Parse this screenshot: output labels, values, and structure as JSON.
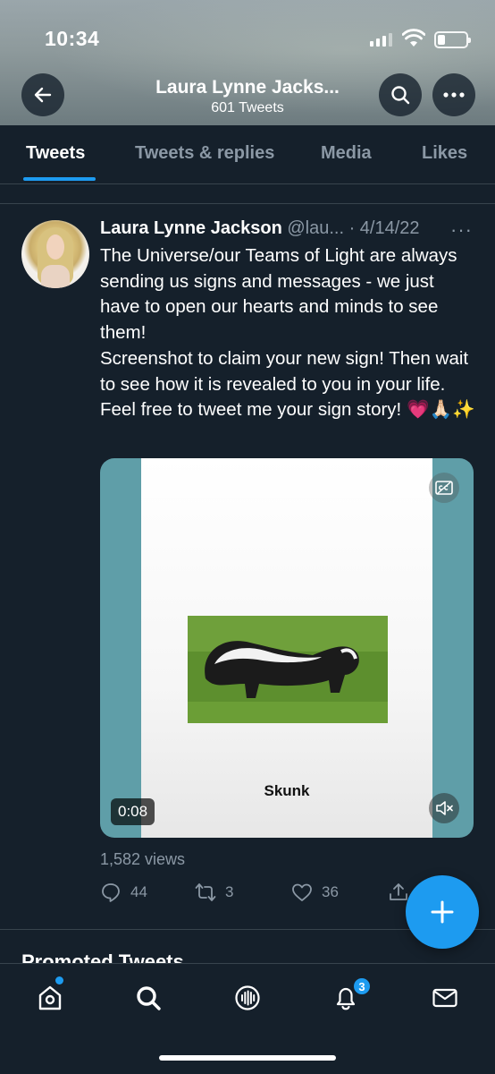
{
  "status_bar": {
    "time": "10:34",
    "battery_level": 0.25
  },
  "header": {
    "profile_name": "Laura Lynne Jacks...",
    "tweet_count": "601 Tweets",
    "back_icon": "arrow-left-icon",
    "search_icon": "search-icon",
    "more_icon": "more-horizontal-icon"
  },
  "tabs": [
    {
      "label": "Tweets",
      "active": true
    },
    {
      "label": "Tweets & replies",
      "active": false
    },
    {
      "label": "Media",
      "active": false
    },
    {
      "label": "Likes",
      "active": false
    }
  ],
  "tweet": {
    "author_name": "Laura Lynne Jackson",
    "handle": "@lau...",
    "date": "· 4/14/22",
    "more": "···",
    "text": "The Universe/our Teams of Light are always sending us signs and messages - we just have to open our hearts and minds to see them!\nScreenshot to claim your new sign! Then wait to see how it is revealed to you in your life. Feel free to tweet me your sign story! 💗🙏🏻✨",
    "media": {
      "caption": "Skunk",
      "duration": "0:08",
      "cc_icon": "closed-captions-icon",
      "mute_icon": "volume-mute-icon"
    },
    "views": "1,582 views",
    "actions": {
      "replies": "44",
      "retweets": "3",
      "likes": "36"
    }
  },
  "section_title": "Promoted Tweets",
  "bottom_nav": {
    "notifications_badge": "3",
    "items": [
      "home-icon",
      "search-icon",
      "spaces-icon",
      "notifications-icon",
      "messages-icon"
    ]
  },
  "colors": {
    "background": "#15202b",
    "accent": "#1d9bf0",
    "muted": "#8b98a5",
    "divider": "#38444d"
  }
}
